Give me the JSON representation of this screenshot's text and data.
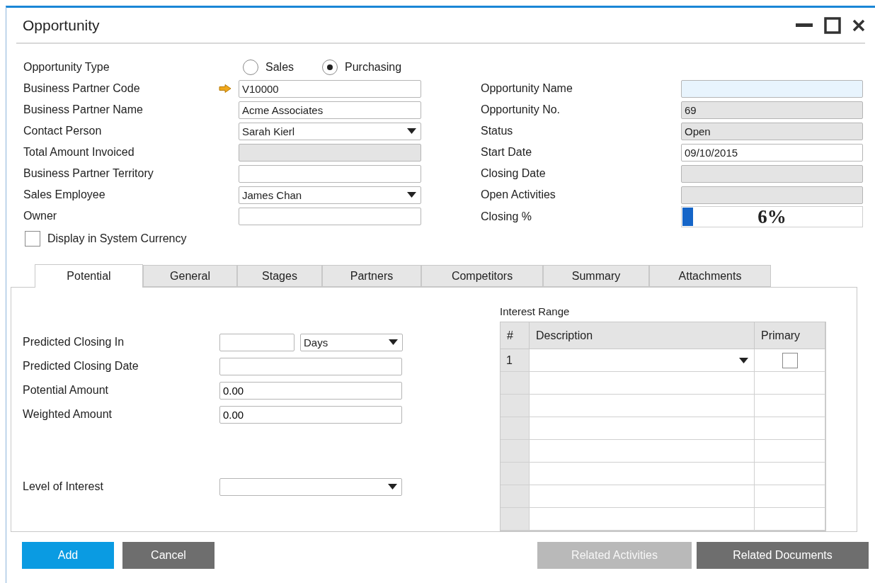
{
  "window": {
    "title": "Opportunity"
  },
  "opportunity_type": {
    "label": "Opportunity Type",
    "options": [
      {
        "label": "Sales",
        "selected": false
      },
      {
        "label": "Purchasing",
        "selected": true
      }
    ]
  },
  "left_fields": [
    {
      "label": "Business Partner Code",
      "value": "V10000",
      "kind": "link"
    },
    {
      "label": "Business Partner Name",
      "value": "Acme Associates",
      "kind": "text"
    },
    {
      "label": "Contact Person",
      "value": "Sarah Kierl",
      "kind": "dropdown"
    },
    {
      "label": "Total Amount Invoiced",
      "kind": "readonly"
    },
    {
      "label": "Business Partner Territory",
      "kind": "text"
    },
    {
      "label": "Sales Employee",
      "value": "James Chan",
      "kind": "dropdown"
    },
    {
      "label": "Owner",
      "kind": "text"
    }
  ],
  "system_currency": {
    "label": "Display in System Currency",
    "checked": false
  },
  "right_fields": [
    {
      "label": "Opportunity Name",
      "kind": "focused"
    },
    {
      "label": "Opportunity No.",
      "value": "69",
      "kind": "readonly"
    },
    {
      "label": "Status",
      "value": "Open",
      "kind": "readonly"
    },
    {
      "label": "Start Date",
      "value": "09/10/2015",
      "kind": "text"
    },
    {
      "label": "Closing Date",
      "kind": "readonly"
    },
    {
      "label": "Open Activities",
      "kind": "readonly"
    },
    {
      "label": "Closing %",
      "kind": "progress",
      "level": 0.06,
      "reading": "6%"
    }
  ],
  "tabs": [
    {
      "label": "Potential",
      "selected": true
    },
    {
      "label": "General",
      "selected": false
    },
    {
      "label": "Stages",
      "selected": false
    },
    {
      "label": "Partners",
      "selected": false
    },
    {
      "label": "Competitors",
      "selected": false
    },
    {
      "label": "Summary",
      "selected": false
    },
    {
      "label": "Attachments",
      "selected": false
    }
  ],
  "potential": {
    "fields": [
      {
        "label": "Predicted Closing In",
        "kind": "split",
        "unit": "Days"
      },
      {
        "label": "Predicted Closing Date",
        "kind": "text"
      },
      {
        "label": "Potential Amount",
        "value": "0.00",
        "kind": "text"
      },
      {
        "label": "Weighted Amount",
        "value": "0.00",
        "kind": "text"
      },
      {
        "label": "Level of Interest",
        "kind": "dropdown"
      }
    ]
  },
  "interest_range": {
    "title": "Interest Range",
    "columns": [
      "#",
      "Description",
      "Primary"
    ],
    "rows": [
      {
        "number": "1",
        "primary": false
      }
    ]
  },
  "left_buttons": [
    {
      "label": "Add",
      "kind": "primary",
      "disabled": false
    },
    {
      "label": "Cancel",
      "kind": "secondary",
      "disabled": false
    }
  ],
  "right_buttons": [
    {
      "label": "Related Activities",
      "disabled": true
    },
    {
      "label": "Related Documents",
      "disabled": false
    }
  ]
}
